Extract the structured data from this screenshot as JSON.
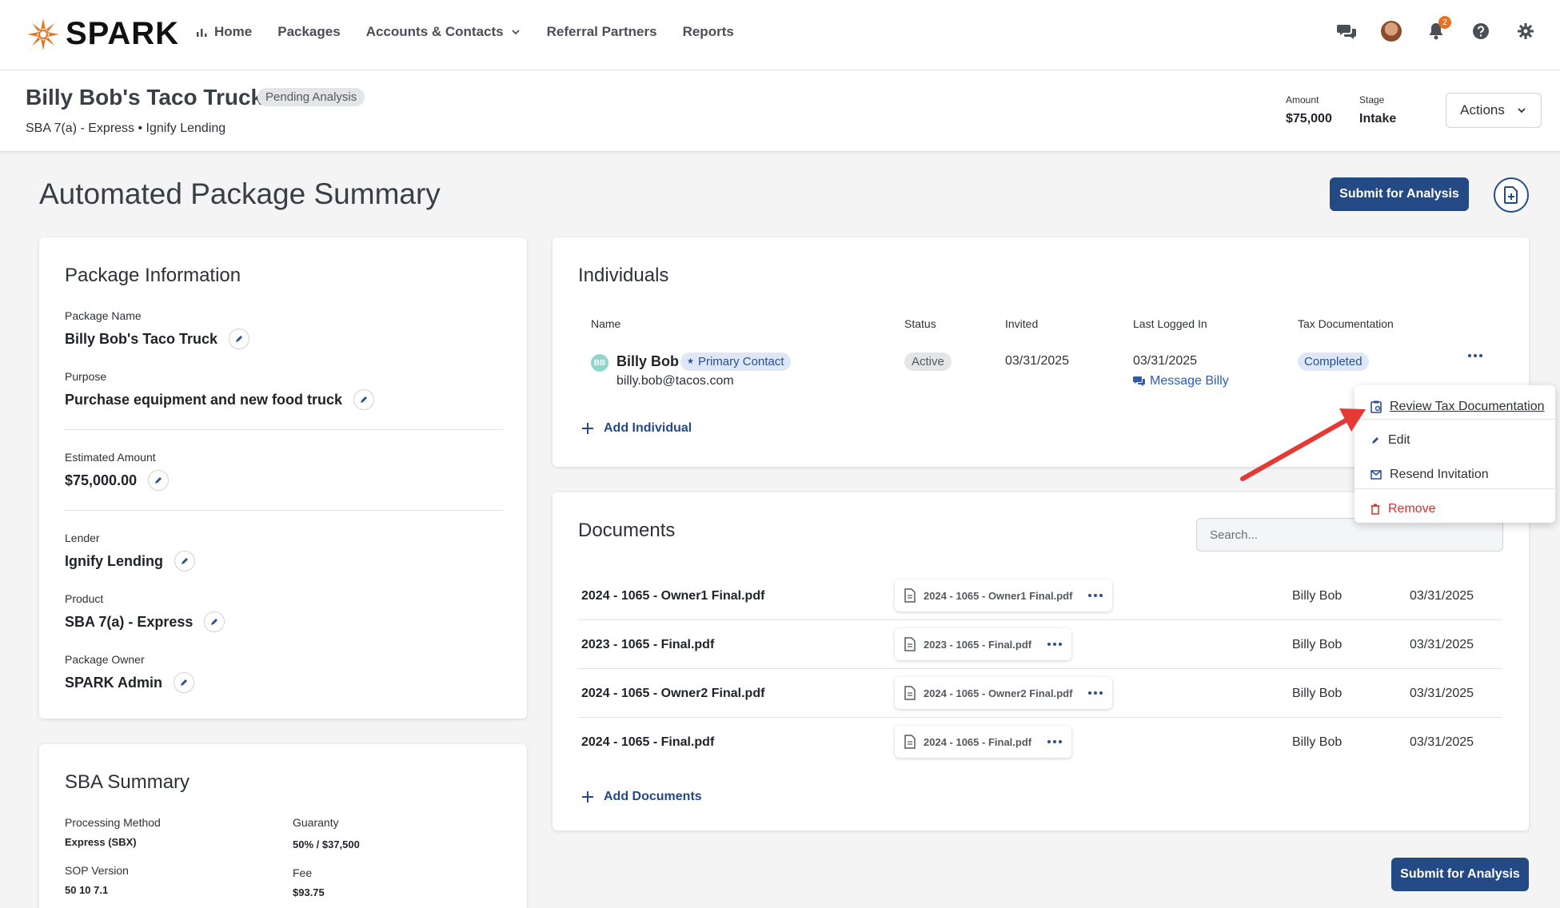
{
  "nav": {
    "brand": "SPARK",
    "links": [
      {
        "label": "Home"
      },
      {
        "label": "Packages"
      },
      {
        "label": "Accounts & Contacts"
      },
      {
        "label": "Referral Partners"
      },
      {
        "label": "Reports"
      }
    ],
    "notification_count": "2"
  },
  "header": {
    "title": "Billy Bob's Taco Truck",
    "status": "Pending Analysis",
    "subtitle": "SBA 7(a) - Express • Ignify Lending",
    "amount_label": "Amount",
    "amount_value": "$75,000",
    "stage_label": "Stage",
    "stage_value": "Intake",
    "actions_label": "Actions"
  },
  "page": {
    "title": "Automated Package Summary",
    "submit_label": "Submit for Analysis"
  },
  "package_info": {
    "title": "Package Information",
    "fields": [
      {
        "label": "Package Name",
        "value": "Billy Bob's Taco Truck"
      },
      {
        "label": "Purpose",
        "value": "Purchase equipment and new food truck"
      },
      {
        "label": "Estimated Amount",
        "value": "$75,000.00"
      },
      {
        "label": "Lender",
        "value": "Ignify Lending"
      },
      {
        "label": "Product",
        "value": "SBA 7(a) - Express"
      },
      {
        "label": "Package Owner",
        "value": "SPARK Admin"
      }
    ]
  },
  "sba_summary": {
    "title": "SBA Summary",
    "fields": [
      {
        "label": "Processing Method",
        "value": "Express (SBX)"
      },
      {
        "label": "Guaranty",
        "value": "50% / $37,500"
      },
      {
        "label": "SOP Version",
        "value": "50 10 7.1"
      },
      {
        "label": "Fee",
        "value": "$93.75"
      }
    ]
  },
  "individuals": {
    "title": "Individuals",
    "columns": [
      "Name",
      "Status",
      "Invited",
      "Last Logged In",
      "Tax Documentation"
    ],
    "rows": [
      {
        "initials": "BB",
        "name": "Billy Bob",
        "badge": "Primary Contact",
        "email": "billy.bob@tacos.com",
        "status": "Active",
        "invited": "03/31/2025",
        "last_logged_in": "03/31/2025",
        "message_link": "Message Billy",
        "tax_documentation": "Completed"
      }
    ],
    "add_label": "Add Individual"
  },
  "row_menu": {
    "items": [
      {
        "label": "Review Tax Documentation",
        "icon": "clipboard-icon"
      },
      {
        "label": "Edit",
        "icon": "pencil-icon"
      },
      {
        "label": "Resend Invitation",
        "icon": "envelope-icon"
      },
      {
        "label": "Remove",
        "icon": "trash-icon"
      }
    ],
    "remove_color": "#d0342c"
  },
  "documents": {
    "title": "Documents",
    "search_placeholder": "Search...",
    "rows": [
      {
        "name": "2024 - 1065 - Owner1 Final.pdf",
        "file": "2024 - 1065 - Owner1 Final.pdf",
        "owner": "Billy Bob",
        "date": "03/31/2025"
      },
      {
        "name": "2023 - 1065 - Final.pdf",
        "file": "2023 - 1065 - Final.pdf",
        "owner": "Billy Bob",
        "date": "03/31/2025"
      },
      {
        "name": "2024 - 1065 - Owner2 Final.pdf",
        "file": "2024 - 1065 - Owner2 Final.pdf",
        "owner": "Billy Bob",
        "date": "03/31/2025"
      },
      {
        "name": "2024 - 1065 - Final.pdf",
        "file": "2024 - 1065 - Final.pdf",
        "owner": "Billy Bob",
        "date": "03/31/2025"
      }
    ],
    "add_label": "Add Documents"
  },
  "colors": {
    "primary": "#244a86",
    "brand_orange": "#e8711f",
    "annotation_arrow": "#e53935"
  }
}
